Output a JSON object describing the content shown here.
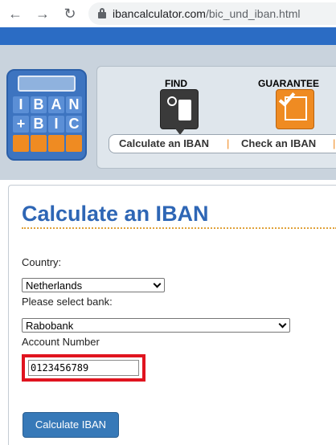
{
  "browser": {
    "url_domain": "ibancalculator.com",
    "url_path": "/bic_und_iban.html"
  },
  "logo": {
    "top_letters": [
      "I",
      "B",
      "A",
      "N"
    ],
    "bottom_letters": [
      "+",
      "B",
      "I",
      "C"
    ]
  },
  "features": {
    "find_label": "FIND",
    "guarantee_label": "GUARANTEE"
  },
  "nav_tabs": [
    {
      "label": "Calculate an IBAN"
    },
    {
      "label": "Check an IBAN"
    }
  ],
  "form": {
    "title": "Calculate an IBAN",
    "country_label": "Country:",
    "country_value": "Netherlands",
    "bank_label": "Please select bank:",
    "bank_value": "Rabobank",
    "account_label": "Account Number",
    "account_value": "0123456789",
    "submit_label": "Calculate IBAN"
  },
  "colors": {
    "accent_blue": "#2e66b5",
    "accent_orange": "#ef8b22",
    "highlight_red": "#e0141f"
  }
}
